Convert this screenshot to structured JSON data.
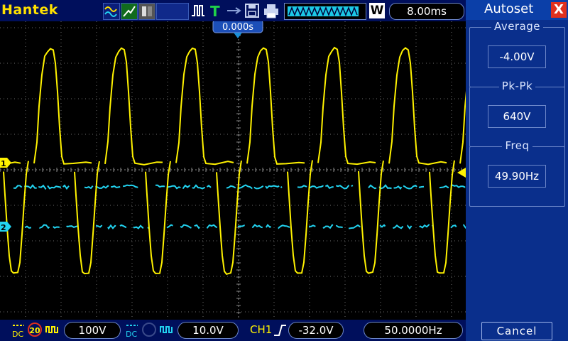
{
  "brand": "Hantek",
  "toolbar": {
    "timebase": "8.00ms",
    "mode_letter": "W",
    "trigger_position": "0.000s"
  },
  "channels": {
    "ch1_marker": "1",
    "ch2_marker": "2",
    "ch1_coupling": "DC",
    "ch1_probe": "20",
    "ch1_scale": "100V",
    "ch2_coupling": "DC",
    "ch2_scale": "10.0V"
  },
  "trigger": {
    "source": "CH1",
    "level": "-32.0V",
    "frequency": "50.0000Hz"
  },
  "panel": {
    "title": "Autoset",
    "close": "X",
    "measurements": [
      {
        "label": "Average",
        "value": "-4.00V"
      },
      {
        "label": "Pk-Pk",
        "value": "640V"
      },
      {
        "label": "Freq",
        "value": "49.90Hz"
      }
    ],
    "cancel": "Cancel"
  },
  "colors": {
    "ch1": "#fff200",
    "ch2": "#22d3f0",
    "accent": "#0b3fa8"
  }
}
